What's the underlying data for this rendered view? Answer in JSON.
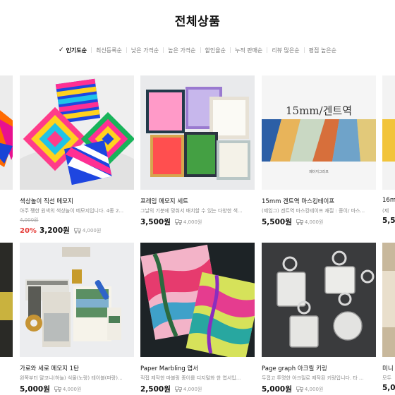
{
  "page": {
    "title": "전체상품"
  },
  "sort": {
    "options": [
      "인기도순",
      "최신등록순",
      "낮은 가격순",
      "높은 가격순",
      "할인율순",
      "누적 판매순",
      "리뷰 많은순",
      "평점 높은순"
    ],
    "selected": "인기도순"
  },
  "products": [
    {
      "name": "",
      "desc": "",
      "orig_price": "",
      "discount": "",
      "price": "",
      "shipping": ""
    },
    {
      "name": "색상놀이 직선 메모지",
      "desc": "아주 쨍한 원색의 색상놀이 메모지입니다. 4종 2...",
      "orig_price": "4,000원",
      "discount": "20%",
      "price": "3,200원",
      "shipping": "4,000원"
    },
    {
      "name": "프레임 메모지 세트",
      "desc": "그날의 기분에 맞춰서 배치할 수 있는 다양한 색...",
      "orig_price": "",
      "discount": "",
      "price": "3,500원",
      "shipping": "4,000원"
    },
    {
      "name": "15mm 겐트역 마스킹테이프",
      "desc": "(제임그) 겐트역 마스킹테이프 재질 : 종이/ 마스...",
      "orig_price": "",
      "discount": "",
      "price": "5,500원",
      "shipping": "4,000원"
    },
    {
      "name": "16m",
      "desc": "(제",
      "orig_price": "",
      "discount": "",
      "price": "5,5",
      "shipping": ""
    },
    {
      "name": "",
      "desc": "",
      "orig_price": "",
      "discount": "",
      "price": "",
      "shipping": ""
    },
    {
      "name": "가로와 세로 메모지 1탄",
      "desc": "왼쪽부터 말코니(하늘) 식물(노랑) 테이블(파랑)...",
      "orig_price": "",
      "discount": "",
      "price": "5,000원",
      "shipping": "4,000원"
    },
    {
      "name": "Paper Marbling 엽서",
      "desc": "직접 제작한 마블링 종이를 디지털화 한 엽서입...",
      "orig_price": "",
      "discount": "",
      "price": "2,500원",
      "shipping": "4,000원"
    },
    {
      "name": "Page graph 아크릴 키링",
      "desc": "두껍고 투명한 아크릴로 제작된 키링입니다. 타 ...",
      "orig_price": "",
      "discount": "",
      "price": "5,000원",
      "shipping": "4,000원"
    },
    {
      "name": "미니",
      "desc": "모두",
      "orig_price": "",
      "discount": "",
      "price": "5,0",
      "shipping": ""
    }
  ],
  "thumb_texts": {
    "tape_title": "15mm/겐트역",
    "tape_caption": "페이지그라프"
  },
  "colors": {
    "discount": "#e53935",
    "text": "#111111",
    "muted": "#888888"
  }
}
